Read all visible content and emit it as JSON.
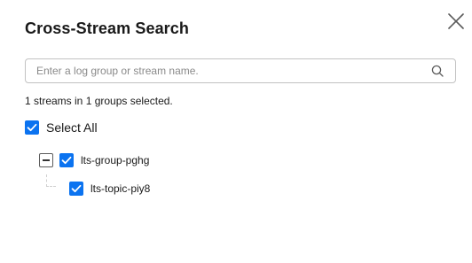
{
  "dialog": {
    "title": "Cross-Stream Search",
    "close_icon": "close-icon"
  },
  "search": {
    "placeholder": "Enter a log group or stream name.",
    "value": "",
    "icon": "search-icon"
  },
  "summary": "1 streams in 1 groups selected.",
  "select_all": {
    "label": "Select All",
    "checked": true
  },
  "tree": {
    "group": {
      "label": "lts-group-pghg",
      "checked": true,
      "expanded": true,
      "toggle_icon": "collapse-icon"
    },
    "streams": [
      {
        "label": "lts-topic-piy8",
        "checked": true
      }
    ]
  },
  "colors": {
    "accent": "#0b73f0",
    "text": "#191919",
    "border": "#c2c2c2"
  }
}
